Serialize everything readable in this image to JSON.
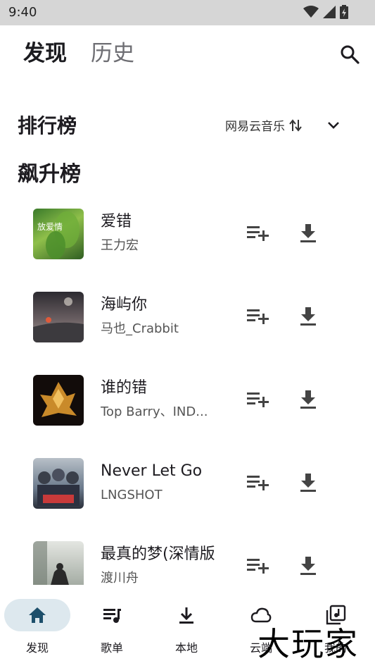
{
  "status_bar": {
    "time": "9:40"
  },
  "header": {
    "tabs": [
      {
        "label": "发现",
        "active": true
      },
      {
        "label": "历史",
        "active": false
      }
    ],
    "search_icon": "search-icon"
  },
  "ranking": {
    "title": "排行榜",
    "source": "网易云音乐",
    "source_icon": "swap-vert-icon",
    "expand_icon": "chevron-down-icon"
  },
  "chart": {
    "name": "飙升榜",
    "songs": [
      {
        "title": "爱错",
        "artist": "王力宏",
        "cover_text": "放爱情"
      },
      {
        "title": "海屿你",
        "artist": "马也_Crabbit"
      },
      {
        "title": "谁的错",
        "artist": "Top Barry、IND..."
      },
      {
        "title": "Never Let Go",
        "artist": "LNGSHOT"
      },
      {
        "title": "最真的梦(深情版",
        "artist": "渡川舟"
      }
    ]
  },
  "nav": {
    "items": [
      {
        "label": "发现",
        "icon": "home-icon",
        "active": true
      },
      {
        "label": "歌单",
        "icon": "queue-music-icon",
        "active": false
      },
      {
        "label": "本地",
        "icon": "download-icon",
        "active": false
      },
      {
        "label": "云端",
        "icon": "cloud-icon",
        "active": false
      },
      {
        "label": "我的",
        "icon": "library-music-icon",
        "active": false
      }
    ]
  },
  "watermark": "大玩家",
  "colors": {
    "nav_active_pill": "#dde8ee",
    "status_bar": "#d6d6d6"
  }
}
